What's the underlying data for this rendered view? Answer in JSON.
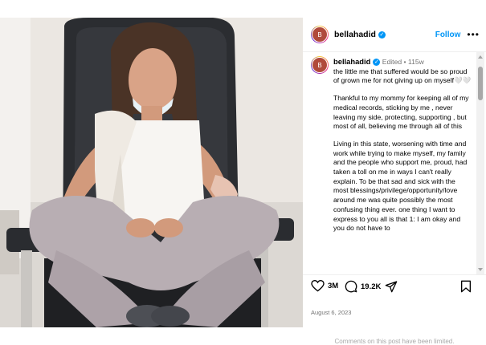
{
  "post": {
    "username": "bellahadid",
    "follow_label": "Follow",
    "more_label": "•••",
    "avatar_initial": "B",
    "verified_mark": "✓"
  },
  "caption": {
    "username": "bellahadid",
    "edited": "Edited",
    "separator": "•",
    "age": "115w",
    "paragraphs": [
      "the little me that suffered would be so proud of grown me for not giving up on myself🤍🤍",
      "Thankful to my mommy for keeping all of my medical records, sticking by me , never leaving my side, protecting, supporting , but most of all, believing me through all of this",
      "Living in this state, worsening with time and work while trying to make myself, my family and the people who support me, proud, had taken a toll on me in ways I can't really explain. To be that sad and sick with the most blessings/privilege/opportunity/love around me was quite possibly the most confusing thing ever. one thing I want to express to you all is that 1: I am okay and you do not have to"
    ]
  },
  "actions": {
    "likes": "3M",
    "comments": "19.2K",
    "date": "August 6, 2023",
    "comments_disabled": "Comments on this post have been limited."
  },
  "icons": {
    "like": "heart-icon",
    "comment": "comment-icon",
    "share": "share-icon",
    "save": "bookmark-icon",
    "verified": "verified-badge-icon"
  },
  "colors": {
    "accent": "#0095f6",
    "muted": "#737373"
  }
}
